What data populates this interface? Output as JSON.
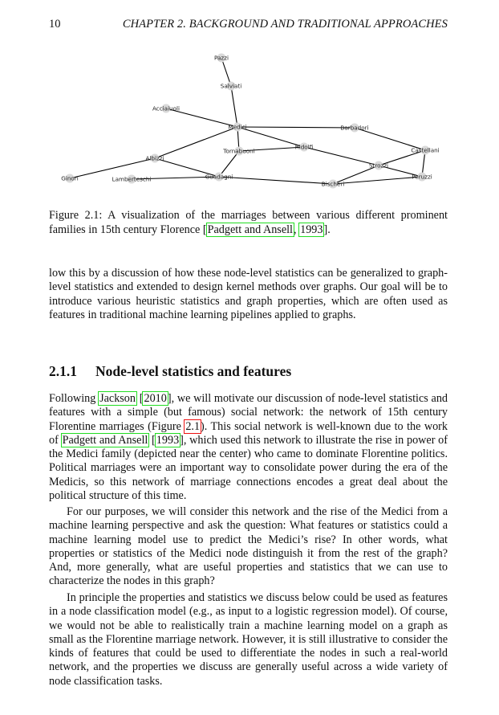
{
  "header": {
    "page_number": "10",
    "running_title": "CHAPTER 2.  BACKGROUND AND TRADITIONAL APPROACHES"
  },
  "figure": {
    "nodes": [
      {
        "id": "Pazzi",
        "label": "Pazzi"
      },
      {
        "id": "Salviati",
        "label": "Salviati"
      },
      {
        "id": "Acciaiuoli",
        "label": "Acciaiuoli"
      },
      {
        "id": "Medici",
        "label": "Medici"
      },
      {
        "id": "Barbadori",
        "label": "Barbadori"
      },
      {
        "id": "Tornabuoni",
        "label": "Tornabuoni"
      },
      {
        "id": "Ridolfi",
        "label": "Ridolfi"
      },
      {
        "id": "Castellani",
        "label": "Castellani"
      },
      {
        "id": "Albizzi",
        "label": "Albizzi"
      },
      {
        "id": "Strozzi",
        "label": "Strozzi"
      },
      {
        "id": "Ginori",
        "label": "Ginori"
      },
      {
        "id": "Lamberteschi",
        "label": "Lamberteschi"
      },
      {
        "id": "Guadagni",
        "label": "Guadagni"
      },
      {
        "id": "Peruzzi",
        "label": "Peruzzi"
      },
      {
        "id": "Bischeri",
        "label": "Bischeri"
      }
    ],
    "edges": [
      [
        "Pazzi",
        "Salviati"
      ],
      [
        "Salviati",
        "Medici"
      ],
      [
        "Acciaiuoli",
        "Medici"
      ],
      [
        "Medici",
        "Barbadori"
      ],
      [
        "Medici",
        "Tornabuoni"
      ],
      [
        "Medici",
        "Ridolfi"
      ],
      [
        "Medici",
        "Albizzi"
      ],
      [
        "Tornabuoni",
        "Ridolfi"
      ],
      [
        "Tornabuoni",
        "Guadagni"
      ],
      [
        "Ridolfi",
        "Strozzi"
      ],
      [
        "Barbadori",
        "Castellani"
      ],
      [
        "Castellani",
        "Strozzi"
      ],
      [
        "Castellani",
        "Peruzzi"
      ],
      [
        "Strozzi",
        "Peruzzi"
      ],
      [
        "Strozzi",
        "Bischeri"
      ],
      [
        "Peruzzi",
        "Bischeri"
      ],
      [
        "Albizzi",
        "Ginori"
      ],
      [
        "Albizzi",
        "Guadagni"
      ],
      [
        "Lamberteschi",
        "Guadagni"
      ],
      [
        "Guadagni",
        "Bischeri"
      ]
    ],
    "colors": {
      "node": "#d9d9d9",
      "edge": "#000000",
      "citation_box": "#22dd22",
      "ref_box": "#ee1111"
    },
    "caption": {
      "prefix": "Figure 2.1:  A visualization of the marriages between various different prominent families in 15th century Florence [",
      "cite_authors": "Padgett and Ansell",
      "sep": ", ",
      "cite_year": "1993",
      "suffix": "]."
    }
  },
  "intro_paragraph": "low this by a discussion of how these node-level statistics can be generalized to graph-level statistics and extended to design kernel methods over graphs.  Our goal will be to introduce various heuristic statistics and graph properties, which are often used as features in traditional machine learning pipelines applied to graphs.",
  "section": {
    "number": "2.1.1",
    "title": "Node-level statistics and features"
  },
  "paragraph1": {
    "t1": "Following ",
    "cite1_authors": "Jackson",
    "t2": " [",
    "cite1_year": "2010",
    "t3": "], we will motivate our discussion of node-level statistics and features with a simple (but famous) social network:  the network of 15th century Florentine marriages (Figure ",
    "fig_ref": "2.1",
    "t4": ").  This social network is well-known due to the work of ",
    "cite2_authors": "Padgett and Ansell",
    "t5": " [",
    "cite2_year": "1993",
    "t6": "], which used this network to illustrate the rise in power of the Medici family (depicted near the center) who came to dominate Florentine politics.  Political marriages were an important way to consolidate power during the era of the Medicis, so this network of marriage connections encodes a great deal about the political structure of this time."
  },
  "paragraph2": "For our purposes, we will consider this network and the rise of the Medici from a machine learning perspective and ask the question:  What features or statistics could a machine learning model use to predict the Medici’s rise?  In other words, what properties or statistics of the Medici node distinguish it from the rest of the graph?  And, more generally, what are useful properties and statistics that we can use to characterize the nodes in this graph?",
  "paragraph3": "In principle the properties and statistics we discuss below could be used as features in a node classification model (e.g., as input to a logistic regression model).  Of course, we would not be able to realistically train a machine learning model on a graph as small as the Florentine marriage network.  However, it is still illustrative to consider the kinds of features that could be used to differentiate the nodes in such a real-world network, and the properties we discuss are generally useful across a wide variety of node classification tasks."
}
